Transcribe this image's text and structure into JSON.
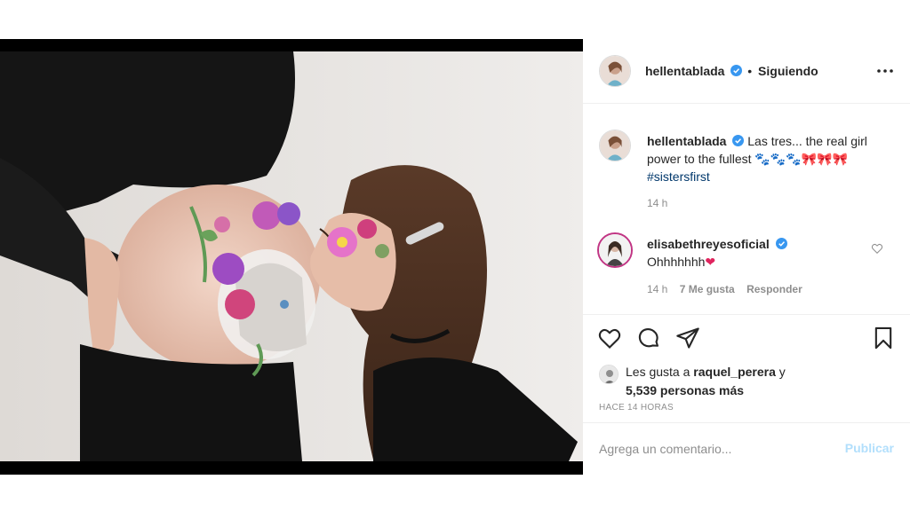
{
  "post": {
    "username": "hellentablada",
    "dot": "•",
    "following_label": "Siguiendo",
    "more_icon": "more-horizontal-icon",
    "caption": {
      "text": "Las tres... the real girl power to the fullest 🐾🐾🐾🎀🎀🎀",
      "hashtag": "#sistersfirst",
      "time": "14 h"
    },
    "comments": [
      {
        "username": "elisabethreyesoficial",
        "text": "Ohhhhhhh",
        "emoji": "❤",
        "time": "14 h",
        "likes": "7 Me gusta",
        "reply_label": "Responder"
      }
    ],
    "actions": {
      "like_icon": "heart-icon",
      "comment_icon": "comment-icon",
      "share_icon": "send-icon",
      "save_icon": "bookmark-icon"
    },
    "likes": {
      "prefix": "Les gusta a",
      "user": "raquel_perera",
      "connector": "y",
      "others": "5,539 personas más"
    },
    "timestamp": "Hace 14 horas",
    "add_comment": {
      "placeholder": "Agrega un comentario...",
      "post_label": "Publicar"
    }
  },
  "colors": {
    "verified": "#3897f0",
    "link": "#00376b",
    "muted": "#8e8e8e",
    "post_disabled": "#b2dffc"
  }
}
